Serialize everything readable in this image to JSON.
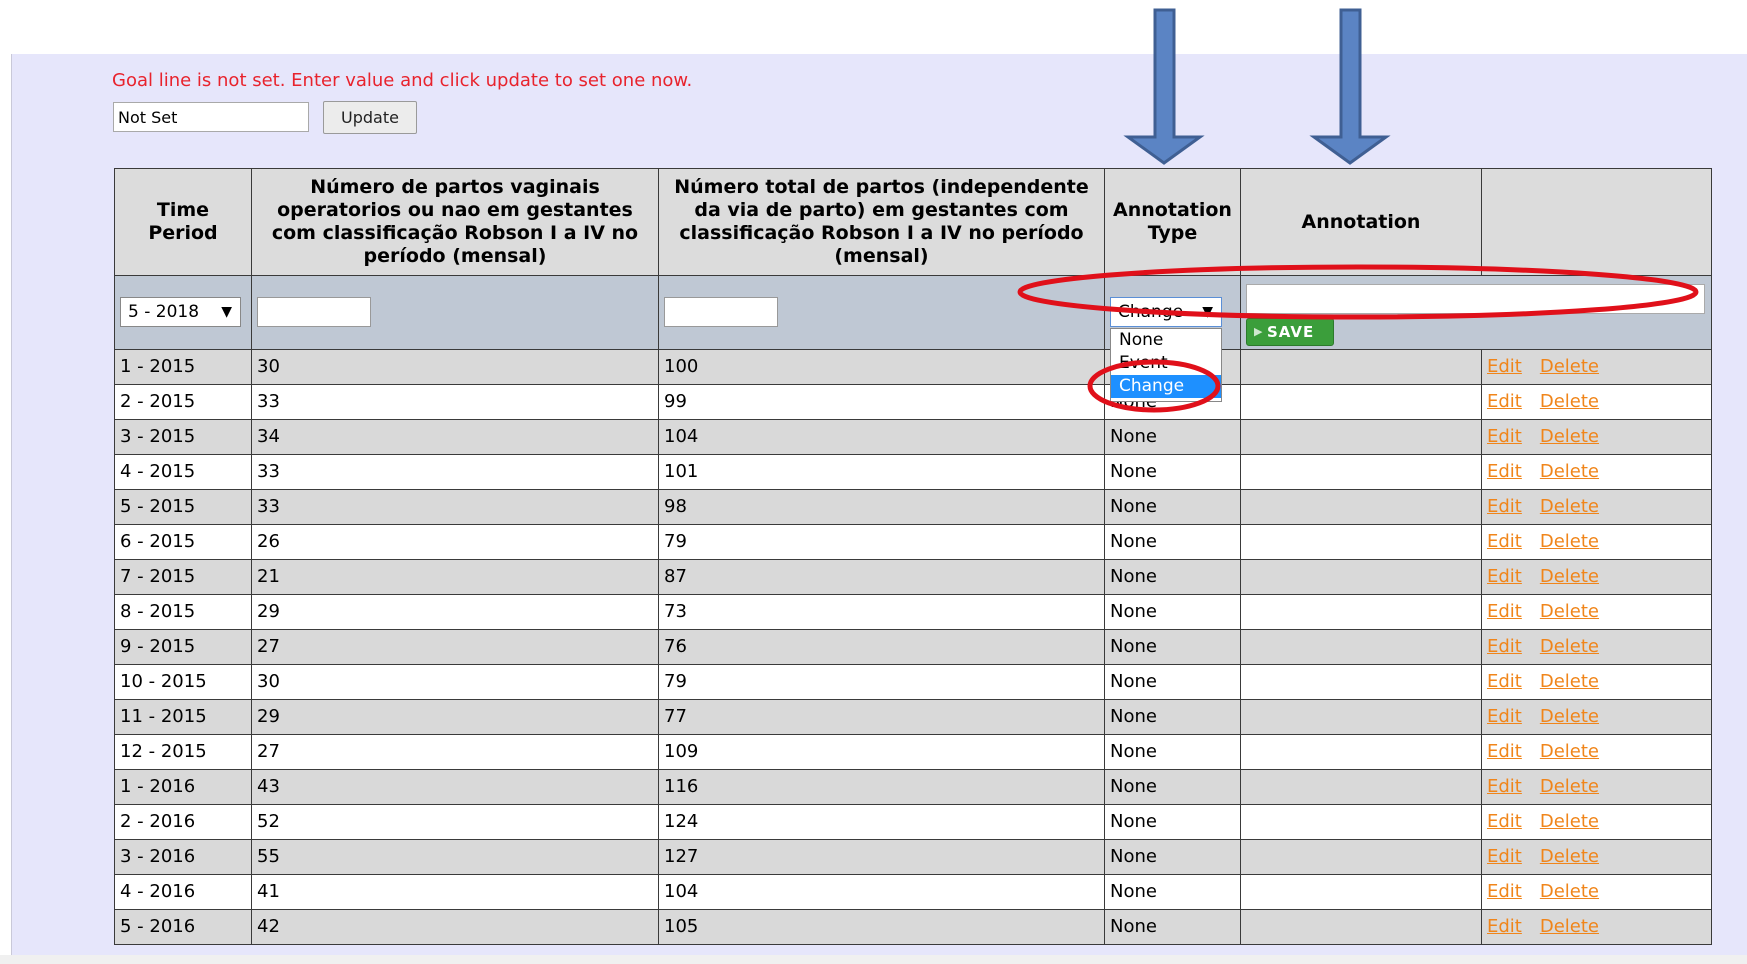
{
  "goal": {
    "message": "Goal line is not set. Enter value and click update to set one now.",
    "input_value": "Not Set",
    "update_label": "Update"
  },
  "table": {
    "headers": [
      "Time Period",
      "Número de partos vaginais operatorios ou nao em gestantes com classificação Robson I a IV no período (mensal)",
      "Número total de partos (independente da via de parto) em gestantes com classificação Robson I a IV no período (mensal)",
      "Annotation Type",
      "Annotation",
      ""
    ],
    "input_row": {
      "period_value": "5 - 2018",
      "annotation_type_value": "Change",
      "save_label": "SAVE"
    },
    "rows": [
      {
        "period": "1 - 2015",
        "num": "30",
        "total": "100",
        "type": "None",
        "annotation": ""
      },
      {
        "period": "2 - 2015",
        "num": "33",
        "total": "99",
        "type": "None",
        "annotation": ""
      },
      {
        "period": "3 - 2015",
        "num": "34",
        "total": "104",
        "type": "None",
        "annotation": ""
      },
      {
        "period": "4 - 2015",
        "num": "33",
        "total": "101",
        "type": "None",
        "annotation": ""
      },
      {
        "period": "5 - 2015",
        "num": "33",
        "total": "98",
        "type": "None",
        "annotation": ""
      },
      {
        "period": "6 - 2015",
        "num": "26",
        "total": "79",
        "type": "None",
        "annotation": ""
      },
      {
        "period": "7 - 2015",
        "num": "21",
        "total": "87",
        "type": "None",
        "annotation": ""
      },
      {
        "period": "8 - 2015",
        "num": "29",
        "total": "73",
        "type": "None",
        "annotation": ""
      },
      {
        "period": "9 - 2015",
        "num": "27",
        "total": "76",
        "type": "None",
        "annotation": ""
      },
      {
        "period": "10 - 2015",
        "num": "30",
        "total": "79",
        "type": "None",
        "annotation": ""
      },
      {
        "period": "11 - 2015",
        "num": "29",
        "total": "77",
        "type": "None",
        "annotation": ""
      },
      {
        "period": "12 - 2015",
        "num": "27",
        "total": "109",
        "type": "None",
        "annotation": ""
      },
      {
        "period": "1 - 2016",
        "num": "43",
        "total": "116",
        "type": "None",
        "annotation": ""
      },
      {
        "period": "2 - 2016",
        "num": "52",
        "total": "124",
        "type": "None",
        "annotation": ""
      },
      {
        "period": "3 - 2016",
        "num": "55",
        "total": "127",
        "type": "None",
        "annotation": ""
      },
      {
        "period": "4 - 2016",
        "num": "41",
        "total": "104",
        "type": "None",
        "annotation": ""
      },
      {
        "period": "5 - 2016",
        "num": "42",
        "total": "105",
        "type": "None",
        "annotation": ""
      }
    ],
    "edit_label": "Edit",
    "delete_label": "Delete"
  },
  "dropdown_options": [
    {
      "label": "None",
      "selected": false
    },
    {
      "label": "Event",
      "selected": false
    },
    {
      "label": "Change",
      "selected": true
    }
  ],
  "annotation_colors": {
    "arrow": "#5b84c4",
    "arrow_stroke": "#3f5f93",
    "highlight_ring": "#e0101a"
  }
}
